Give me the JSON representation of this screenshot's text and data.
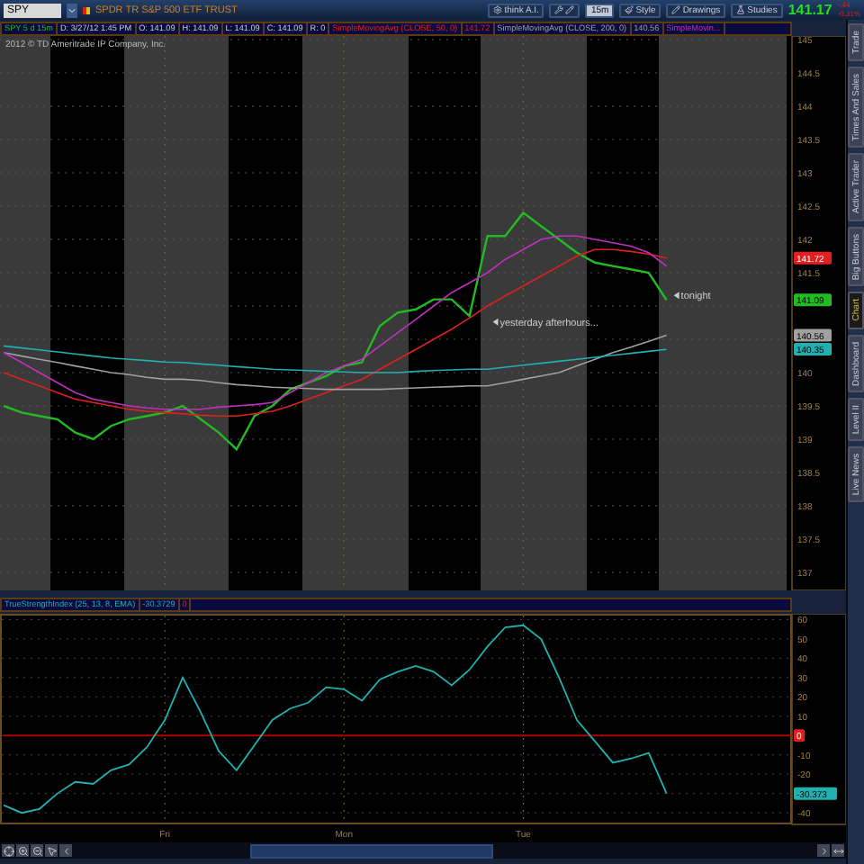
{
  "toolbar": {
    "symbol": "SPY",
    "description": "SPDR TR S&P 500 ETF TRUST",
    "buttons": [
      {
        "kind": "labeled",
        "label": "think A.I."
      },
      {
        "kind": "icon"
      },
      {
        "kind": "boxed",
        "label": "15m"
      },
      {
        "kind": "labeled",
        "label": "Style"
      },
      {
        "kind": "labeled",
        "label": "Drawings"
      },
      {
        "kind": "labeled",
        "label": "Studies"
      }
    ],
    "last_price": "141.17",
    "change": "-.44",
    "change_percent": "-0.31%"
  },
  "info_fields": [
    "D: 3/27/12 1:45 PM",
    "O: 141.09",
    "H: 141.09",
    "L: 141.09",
    "C: 141.09",
    "R: 0"
  ],
  "legend_values": [
    "141.72",
    "140.56"
  ],
  "copyright": "2012 © TD Ameritrade IP Company, Inc.",
  "price_badges": [
    {
      "text": "141.72",
      "color": "#e02020"
    },
    {
      "text": "141.09",
      "color": "#22bb22"
    },
    {
      "text": "140.56",
      "color": "#a0a0a0"
    },
    {
      "text": "140.35",
      "color": "#20b0b0"
    }
  ],
  "price_chart": {
    "notes": [
      "yesterday afterhours...",
      "tonight"
    ],
    "chart_data": {
      "type": "line",
      "grid": true,
      "categories": [
        null,
        null,
        null,
        null,
        null,
        null,
        null,
        null,
        null,
        null,
        null,
        null,
        null,
        null,
        null,
        null,
        null,
        null,
        null,
        null,
        null,
        null,
        null,
        null,
        null,
        null,
        null,
        null,
        null,
        null,
        null,
        null,
        null,
        null,
        null,
        null,
        null,
        null,
        null,
        null,
        null,
        null,
        null,
        null,
        null
      ],
      "ylim": [
        137,
        145
      ],
      "yticks": [
        137,
        137.5,
        138,
        138.5,
        139,
        139.5,
        140,
        141.5,
        142,
        142.5,
        143,
        143.5,
        144,
        144.5,
        145
      ],
      "series": [
        {
          "name": "SPY 5 d 15m",
          "color": "#22bb22",
          "values": [
            139.5,
            139.4,
            139.35,
            139.3,
            139.1,
            139.0,
            139.2,
            139.3,
            139.35,
            139.4,
            139.5,
            139.3,
            139.1,
            138.85,
            139.35,
            139.5,
            139.75,
            139.85,
            139.95,
            140.1,
            140.15,
            140.7,
            140.9,
            140.95,
            141.1,
            141.1,
            140.85,
            142.05,
            142.05,
            142.4,
            142.2,
            142.0,
            141.8,
            141.65,
            141.6,
            141.55,
            141.5,
            141.09,
            null,
            null,
            null,
            null,
            null,
            null,
            null
          ]
        },
        {
          "name": "SimpleMovingAvg (CLOSE, 50, 0)",
          "color": "#e02020",
          "values": [
            140.0,
            139.9,
            139.8,
            139.7,
            139.6,
            139.55,
            139.5,
            139.45,
            139.42,
            139.4,
            139.38,
            139.36,
            139.35,
            139.35,
            139.38,
            139.42,
            139.5,
            139.6,
            139.7,
            139.8,
            139.9,
            140.05,
            140.2,
            140.35,
            140.5,
            140.65,
            140.82,
            141.0,
            141.15,
            141.3,
            141.45,
            141.6,
            141.75,
            141.85,
            141.85,
            141.82,
            141.78,
            141.72,
            null,
            null,
            null,
            null,
            null,
            null,
            null
          ]
        },
        {
          "name": "SimpleMovingAvg (CLOSE, 200, 0)",
          "color": "#a0a0a0",
          "values": [
            140.3,
            140.25,
            140.2,
            140.15,
            140.1,
            140.05,
            140.0,
            139.97,
            139.93,
            139.9,
            139.9,
            139.88,
            139.85,
            139.82,
            139.8,
            139.78,
            139.77,
            139.76,
            139.75,
            139.75,
            139.75,
            139.75,
            139.76,
            139.77,
            139.78,
            139.79,
            139.8,
            139.8,
            139.85,
            139.9,
            139.95,
            140.0,
            140.1,
            140.2,
            140.3,
            140.38,
            140.47,
            140.56,
            null,
            null,
            null,
            null,
            null,
            null,
            null
          ]
        },
        {
          "name": "SimpleMovin...",
          "color": "#c030c0",
          "values": [
            140.3,
            140.15,
            140.0,
            139.85,
            139.7,
            139.6,
            139.55,
            139.5,
            139.47,
            139.45,
            139.45,
            139.45,
            139.48,
            139.5,
            139.52,
            139.55,
            139.7,
            139.85,
            140.0,
            140.1,
            140.2,
            140.4,
            140.6,
            140.8,
            141.0,
            141.2,
            141.35,
            141.5,
            141.7,
            141.85,
            142.0,
            142.05,
            142.05,
            142.0,
            141.95,
            141.9,
            141.8,
            141.6,
            null,
            null,
            null,
            null,
            null,
            null,
            null
          ]
        },
        {
          "color": "#20b0b0",
          "values": [
            140.4,
            140.37,
            140.34,
            140.31,
            140.28,
            140.25,
            140.22,
            140.2,
            140.18,
            140.16,
            140.15,
            140.13,
            140.11,
            140.09,
            140.07,
            140.05,
            140.04,
            140.03,
            140.02,
            140.01,
            140.0,
            140.0,
            140.0,
            140.02,
            140.03,
            140.04,
            140.05,
            140.05,
            140.08,
            140.11,
            140.14,
            140.17,
            140.2,
            140.23,
            140.26,
            140.29,
            140.32,
            140.35,
            null,
            null,
            null,
            null,
            null,
            null,
            null
          ]
        }
      ]
    }
  },
  "side_tabs": [
    {
      "label": "Trade",
      "selected": false
    },
    {
      "label": "Times And Sales",
      "selected": false
    },
    {
      "label": "Active Trader",
      "selected": false
    },
    {
      "label": "Big Buttons",
      "selected": false
    },
    {
      "label": "Chart",
      "selected": true
    },
    {
      "label": "Dashboard",
      "selected": false
    },
    {
      "label": "Level II",
      "selected": false
    },
    {
      "label": "Live News",
      "selected": false
    }
  ],
  "study": {
    "value": "-30.3729",
    "header_zero": "0",
    "badge": "-30.373",
    "chart_data": {
      "type": "line",
      "grid": true,
      "categories": [
        null,
        null,
        null,
        null,
        null,
        null,
        null,
        null,
        null,
        "Fri",
        null,
        null,
        null,
        null,
        null,
        null,
        null,
        null,
        null,
        "Mon",
        null,
        null,
        null,
        null,
        null,
        null,
        null,
        null,
        null,
        "Tue",
        null,
        null,
        null,
        null,
        null,
        null,
        null,
        null,
        null,
        null,
        null,
        null,
        null,
        null,
        null
      ],
      "ylim": [
        -46,
        63
      ],
      "yticks": [
        -40,
        -20,
        -10,
        0,
        10,
        20,
        30,
        40,
        50,
        60
      ],
      "series": [
        {
          "name": "TrueStrengthIndex (25, 13, 8, EMA)",
          "color": "#20b0b0",
          "values": [
            -36,
            -40,
            -38,
            -30,
            -24,
            -25,
            -18,
            -15,
            -6,
            8,
            30,
            12,
            -8,
            -18,
            -5,
            8,
            14,
            17,
            25,
            24,
            18,
            29,
            33,
            36,
            33,
            26,
            34,
            46,
            56,
            57,
            50,
            30,
            8,
            -3,
            -14,
            -12,
            -9,
            -30,
            null,
            null,
            null,
            null,
            null,
            null,
            null
          ]
        },
        {
          "color": "#aa0000",
          "values": [
            0,
            0,
            0,
            0,
            0,
            0,
            0,
            0,
            0,
            0,
            0,
            0,
            0,
            0,
            0,
            0,
            0,
            0,
            0,
            0,
            0,
            0,
            0,
            0,
            0,
            0,
            0,
            0,
            0,
            0,
            0,
            0,
            0,
            0,
            0,
            0,
            0,
            0,
            0,
            0,
            0,
            0,
            0,
            0,
            0
          ]
        }
      ]
    }
  }
}
